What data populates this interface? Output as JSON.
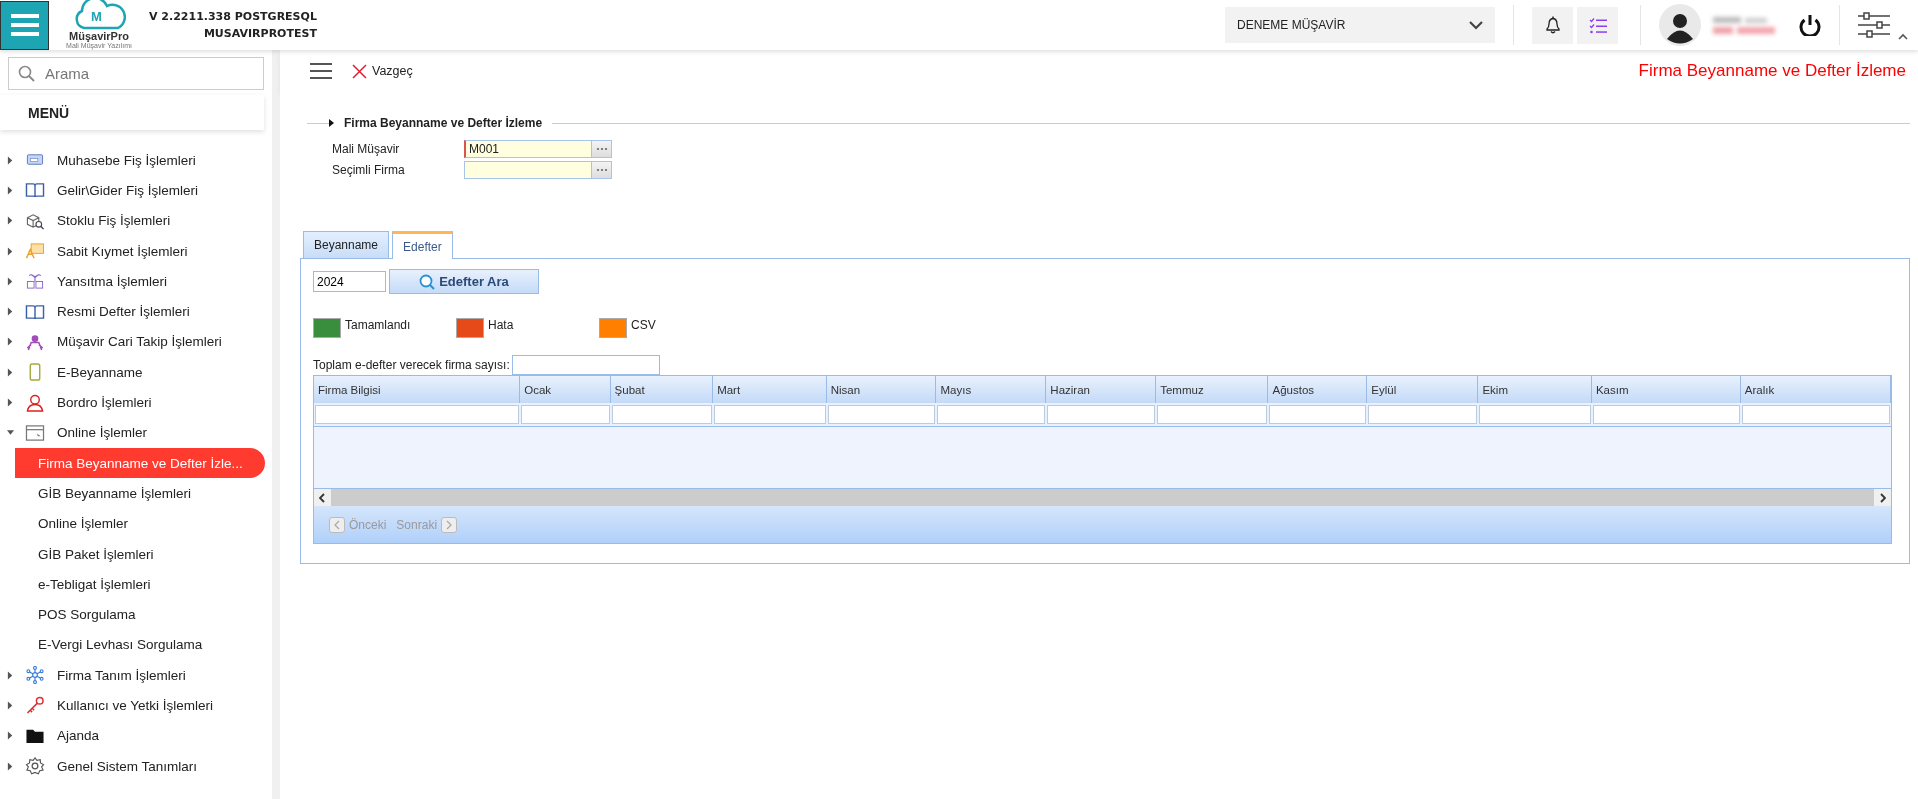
{
  "topbar": {
    "logo": {
      "mark": "M",
      "name": "MüşavirPro",
      "tagline": "Mali Müşavir Yazılımı"
    },
    "version": "V 2.2211.338 POSTGRESQL",
    "database": "MUSAVIRPROTEST",
    "company_select": {
      "value": "DENEME MÜŞAVİR"
    }
  },
  "sidebar": {
    "search": {
      "placeholder": "Arama"
    },
    "menu_title": "MENÜ",
    "items": [
      {
        "label": "Muhasebe Fiş İşlemleri",
        "expanded": false
      },
      {
        "label": "Gelir\\Gider Fiş İşlemleri",
        "expanded": false
      },
      {
        "label": "Stoklu Fiş İşlemleri",
        "expanded": false
      },
      {
        "label": "Sabit Kıymet İşlemleri",
        "expanded": false
      },
      {
        "label": "Yansıtma İşlemleri",
        "expanded": false
      },
      {
        "label": "Resmi Defter İşlemleri",
        "expanded": false
      },
      {
        "label": "Müşavir Cari Takip İşlemleri",
        "expanded": false
      },
      {
        "label": "E-Beyanname",
        "expanded": false
      },
      {
        "label": "Bordro İşlemleri",
        "expanded": false
      },
      {
        "label": "Online İşlemler",
        "expanded": true,
        "children": [
          {
            "label": "Firma Beyanname ve Defter İzle...",
            "selected": true
          },
          {
            "label": "GİB Beyanname İşlemleri",
            "selected": false
          },
          {
            "label": "Online İşlemler",
            "selected": false
          },
          {
            "label": "GİB Paket İşlemleri",
            "selected": false
          },
          {
            "label": "e-Tebligat İşlemleri",
            "selected": false
          },
          {
            "label": "POS Sorgulama",
            "selected": false
          },
          {
            "label": "E-Vergi Levhası Sorgulama",
            "selected": false
          }
        ]
      },
      {
        "label": "Firma Tanım İşlemleri",
        "expanded": false
      },
      {
        "label": "Kullanıcı ve Yetki İşlemleri",
        "expanded": false
      },
      {
        "label": "Ajanda",
        "expanded": false
      },
      {
        "label": "Genel Sistem Tanımları",
        "expanded": false
      }
    ]
  },
  "toolbar": {
    "cancel_button": "Vazgeç",
    "page_title": "Firma Beyanname ve Defter İzleme"
  },
  "form": {
    "legend": "Firma Beyanname ve Defter İzleme",
    "fields": [
      {
        "label": "Mali Müşavir",
        "value": "M001",
        "required": true
      },
      {
        "label": "Seçimli Firma",
        "required": false
      }
    ]
  },
  "tabs": [
    {
      "label": "Beyanname",
      "selected": false
    },
    {
      "label": "Edefter",
      "selected": true
    }
  ],
  "edefter": {
    "year": "2024",
    "search_button": "Edefter Ara",
    "legend": [
      {
        "label": "Tamamlandı",
        "color": "#388e3c"
      },
      {
        "label": "Hata",
        "color": "#e64a19"
      },
      {
        "label": "CSV",
        "color": "#ff8000"
      }
    ],
    "total_label": "Toplam e-defter verecek firma sayısı:",
    "table": {
      "columns": [
        "Firma Bilgisi",
        "Ocak",
        "Şubat",
        "Mart",
        "Nisan",
        "Mayıs",
        "Haziran",
        "Temmuz",
        "Ağustos",
        "Eylül",
        "Ekim",
        "Kasım",
        "Aralık"
      ]
    },
    "pager": {
      "previous": "Önceki",
      "next": "Sonraki",
      "disabled": true
    }
  }
}
